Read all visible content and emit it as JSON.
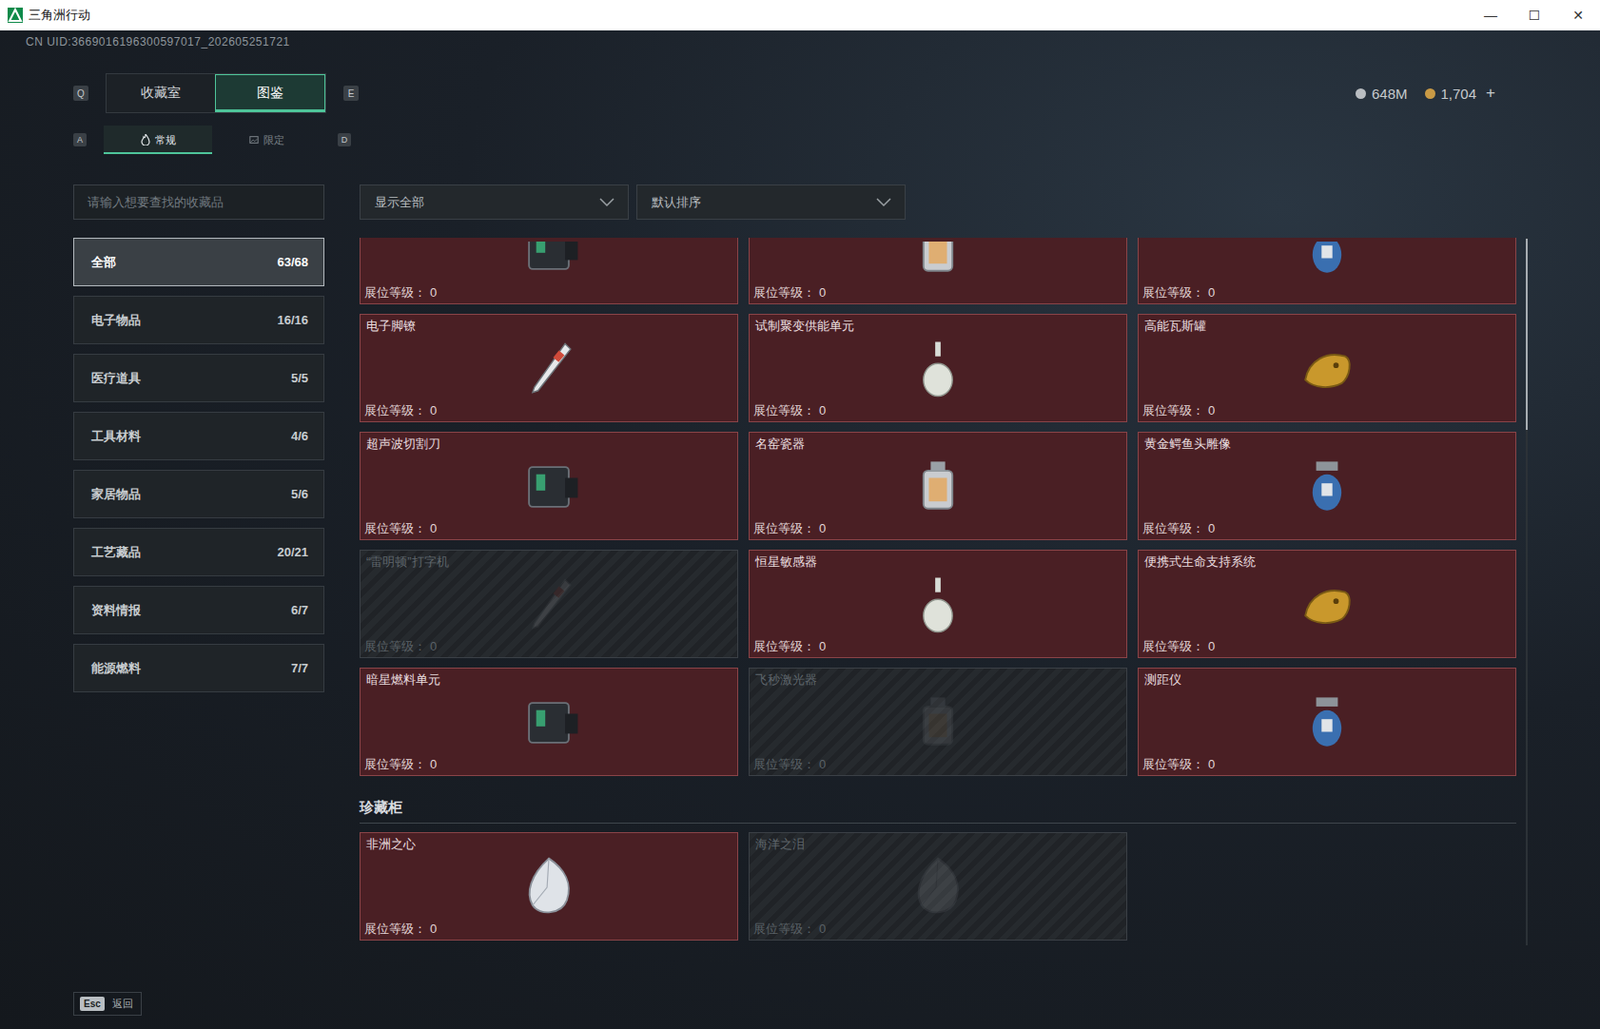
{
  "window": {
    "title": "三角洲行动",
    "controls": [
      "—",
      "☐",
      "✕"
    ]
  },
  "uid": "CN UID:3669016196300597017_202605251721",
  "currency": {
    "items": [
      {
        "amount": "648M",
        "color": "#b9bdc1"
      },
      {
        "amount": "1,704",
        "color": "#c99a45"
      }
    ],
    "add": "+"
  },
  "tabs": {
    "prev_key": "Q",
    "next_key": "E",
    "items": [
      {
        "label": "收藏室",
        "selected": false
      },
      {
        "label": "图鉴",
        "selected": true
      }
    ]
  },
  "subtabs": {
    "prev_key": "A",
    "next_key": "D",
    "items": [
      {
        "label": "常规",
        "selected": true
      },
      {
        "label": "限定",
        "selected": false
      }
    ]
  },
  "search": {
    "placeholder": "请输入想要查找的收藏品"
  },
  "filters": [
    {
      "label": "显示全部"
    },
    {
      "label": "默认排序"
    }
  ],
  "categories": [
    {
      "label": "全部",
      "count": "63/68",
      "selected": true
    },
    {
      "label": "电子物品",
      "count": "16/16",
      "selected": false
    },
    {
      "label": "医疗道具",
      "count": "5/5",
      "selected": false
    },
    {
      "label": "工具材料",
      "count": "4/6",
      "selected": false
    },
    {
      "label": "家居物品",
      "count": "5/6",
      "selected": false
    },
    {
      "label": "工艺藏品",
      "count": "20/21",
      "selected": false
    },
    {
      "label": "资料情报",
      "count": "6/7",
      "selected": false
    },
    {
      "label": "能源燃料",
      "count": "7/7",
      "selected": false
    }
  ],
  "grid": [
    {
      "name": "",
      "grade_label": "展位等级：",
      "grade": "0",
      "collected": true,
      "cut_off": true
    },
    {
      "name": "",
      "grade_label": "展位等级：",
      "grade": "0",
      "collected": true,
      "cut_off": true
    },
    {
      "name": "",
      "grade_label": "展位等级：",
      "grade": "0",
      "collected": true,
      "cut_off": true
    },
    {
      "name": "电子脚镣",
      "grade_label": "展位等级：",
      "grade": "0",
      "collected": true,
      "cut_off": false
    },
    {
      "name": "试制聚变供能单元",
      "grade_label": "展位等级：",
      "grade": "0",
      "collected": true,
      "cut_off": false
    },
    {
      "name": "高能瓦斯罐",
      "grade_label": "展位等级：",
      "grade": "0",
      "collected": true,
      "cut_off": false
    },
    {
      "name": "超声波切割刀",
      "grade_label": "展位等级：",
      "grade": "0",
      "collected": true,
      "cut_off": false
    },
    {
      "name": "名窑瓷器",
      "grade_label": "展位等级：",
      "grade": "0",
      "collected": true,
      "cut_off": false
    },
    {
      "name": "黄金鳄鱼头雕像",
      "grade_label": "展位等级：",
      "grade": "0",
      "collected": true,
      "cut_off": false
    },
    {
      "name": "“雷明顿”打字机",
      "grade_label": "展位等级：",
      "grade": "0",
      "collected": false,
      "cut_off": false
    },
    {
      "name": "恒星敏感器",
      "grade_label": "展位等级：",
      "grade": "0",
      "collected": true,
      "cut_off": false
    },
    {
      "name": "便携式生命支持系统",
      "grade_label": "展位等级：",
      "grade": "0",
      "collected": true,
      "cut_off": false
    },
    {
      "name": "暗星燃料单元",
      "grade_label": "展位等级：",
      "grade": "0",
      "collected": true,
      "cut_off": false
    },
    {
      "name": "飞秒激光器",
      "grade_label": "展位等级：",
      "grade": "0",
      "collected": false,
      "cut_off": false
    },
    {
      "name": "测距仪",
      "grade_label": "展位等级：",
      "grade": "0",
      "collected": true,
      "cut_off": false
    }
  ],
  "showcase": {
    "title": "珍藏柜",
    "cards": [
      {
        "name": "非洲之心",
        "grade_label": "展位等级：",
        "grade": "0",
        "collected": true,
        "cut_off": false
      },
      {
        "name": "海洋之泪",
        "grade_label": "展位等级：",
        "grade": "0",
        "collected": false,
        "cut_off": false
      }
    ]
  },
  "scrollbar": {
    "level": 1,
    "size": 0.27
  },
  "footer": {
    "key": "Esc",
    "label": "返回"
  }
}
